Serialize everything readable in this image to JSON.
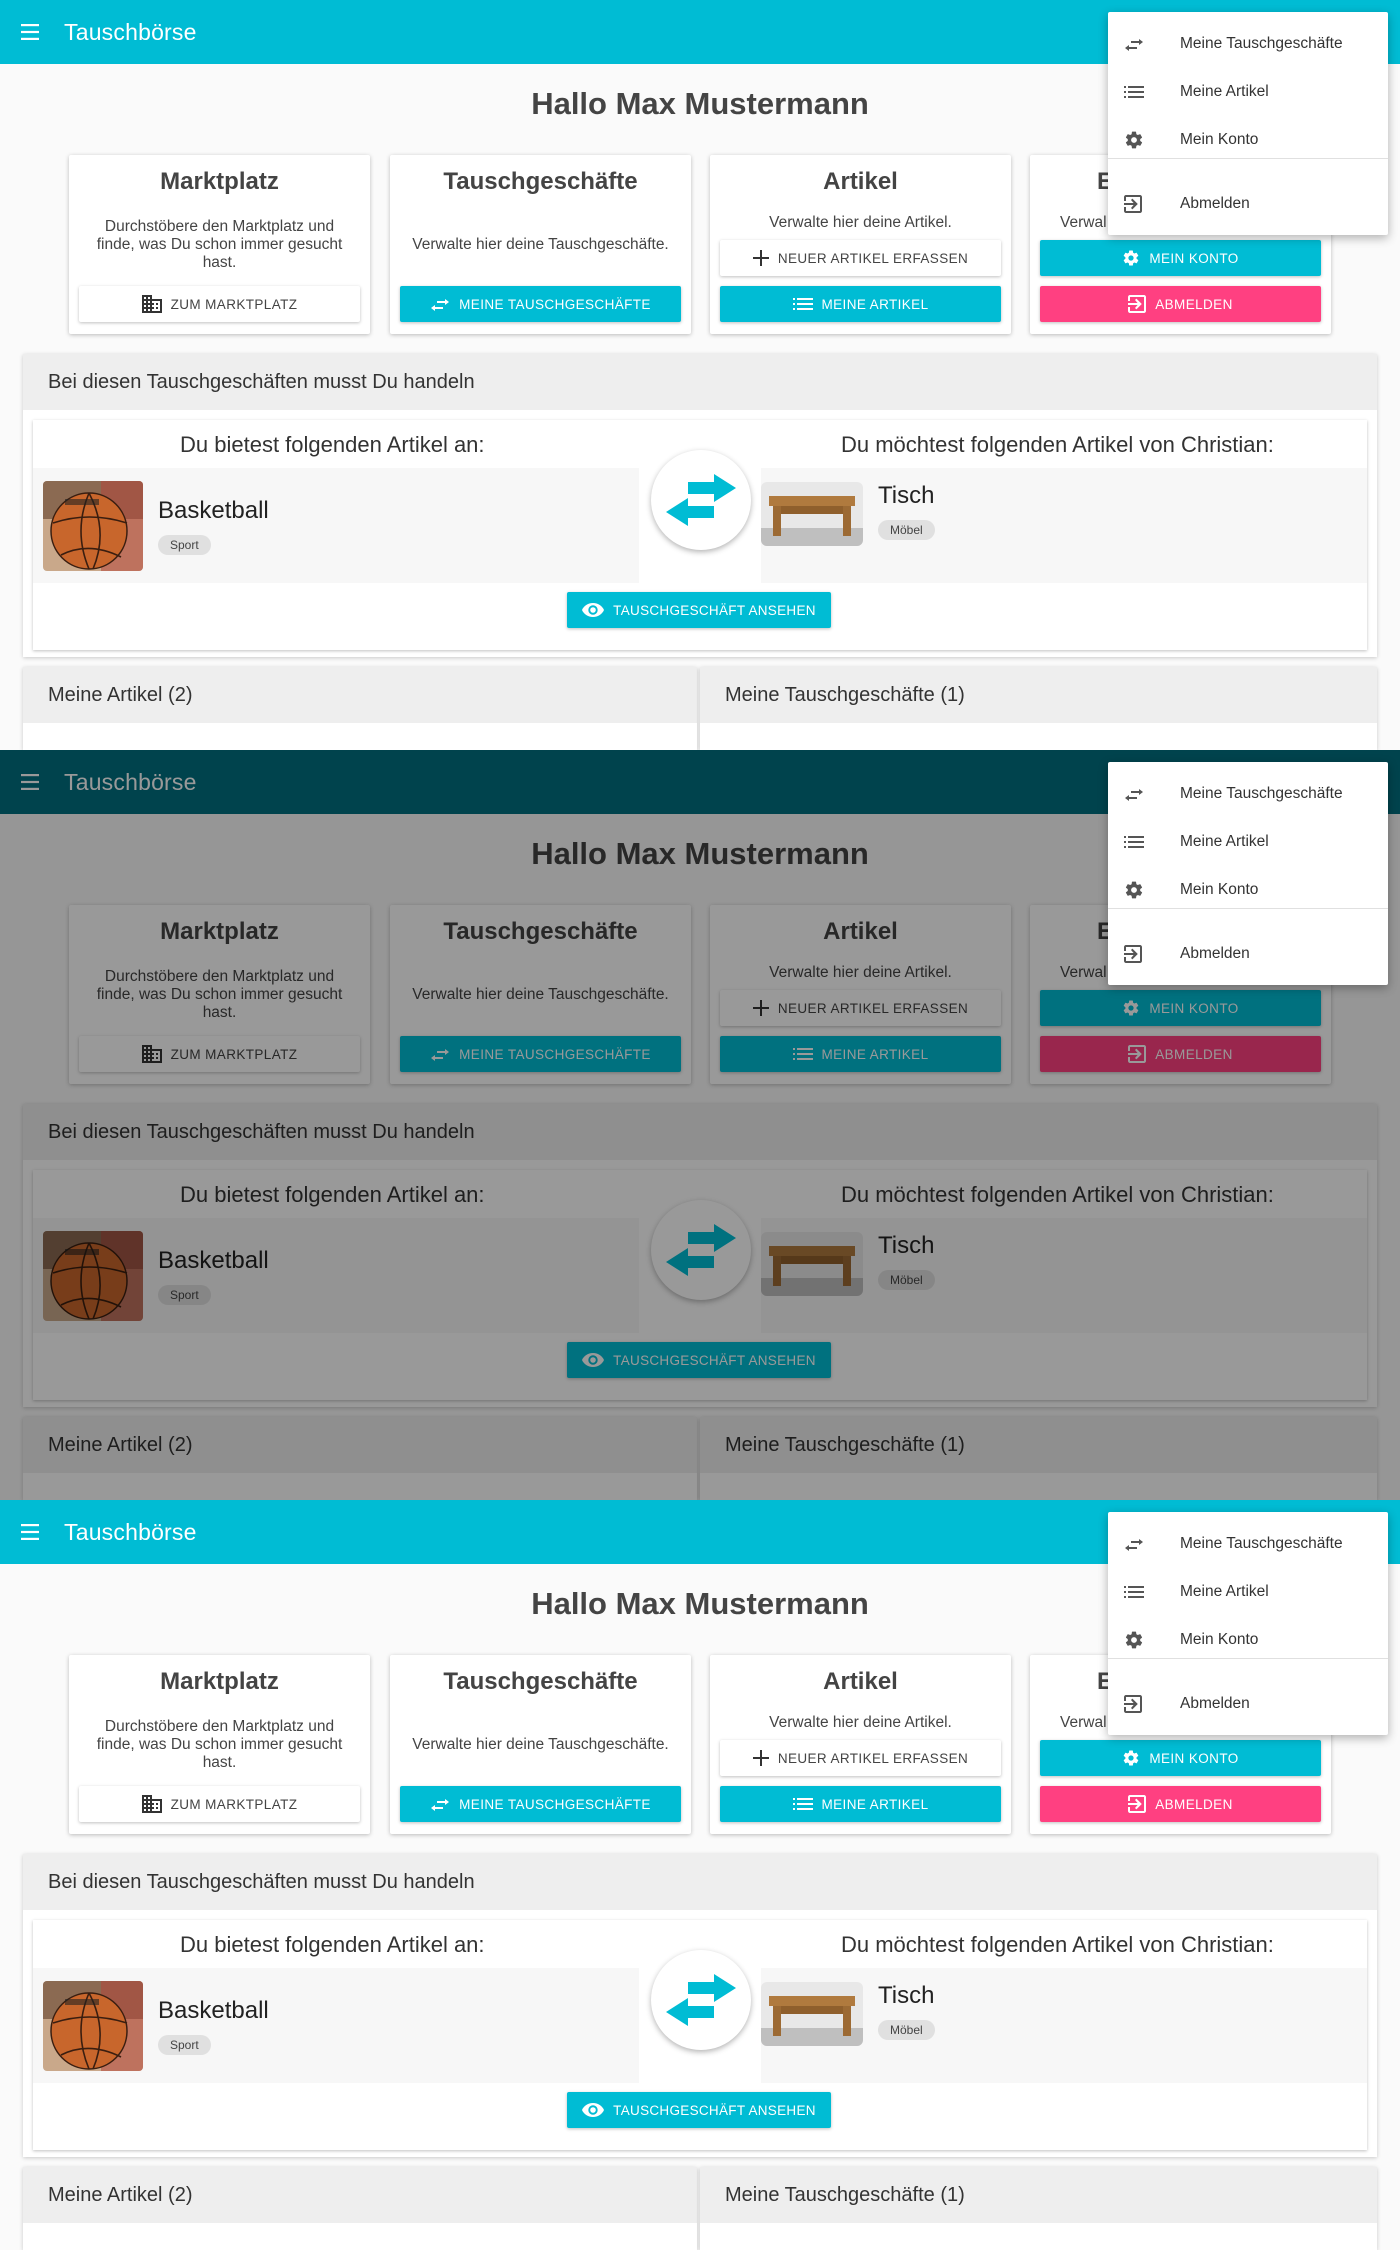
{
  "app": {
    "title": "Tauschbörse",
    "greeting": "Hallo Max Mustermann",
    "accent_color": "#00bcd4",
    "warn_color": "#ff4081"
  },
  "cards": [
    {
      "title": "Marktplatz",
      "description": "Durchstöbere den Marktplatz und finde, was Du schon immer gesucht hast.",
      "buttons": [
        "ZUM MARKTPLATZ"
      ]
    },
    {
      "title": "Tauschgeschäfte",
      "description": "Verwalte hier deine Tauschgeschäfte.",
      "buttons": [
        "MEINE TAUSCHGESCHÄFTE"
      ]
    },
    {
      "title": "Artikel",
      "description": "Verwalte hier deine Artikel.",
      "buttons": [
        "NEUER ARTIKEL ERFASSEN",
        "MEINE ARTIKEL"
      ]
    },
    {
      "title": "E",
      "description": "Verwal",
      "buttons": [
        "MEIN KONTO",
        "ABMELDEN"
      ]
    }
  ],
  "trade_panel": {
    "heading": "Bei diesen Tauschgeschäften musst Du handeln",
    "offer_title": "Du bietest folgenden Artikel an:",
    "want_title": "Du möchtest folgenden Artikel von Christian:",
    "offer_item": {
      "name": "Basketball",
      "category": "Sport",
      "icon": "basketball-image"
    },
    "want_item": {
      "name": "Tisch",
      "category": "Möbel",
      "icon": "table-image"
    },
    "view_button": "TAUSCHGESCHÄFT ANSEHEN"
  },
  "bottom_tabs": [
    "Meine Artikel (2)",
    "Meine Tauschgeschäfte (1)"
  ],
  "menu": {
    "items": [
      {
        "label": "Meine Tauschgeschäfte",
        "icon": "swap-icon"
      },
      {
        "label": "Meine Artikel",
        "icon": "list-icon"
      },
      {
        "label": "Mein Konto",
        "icon": "gear-icon"
      },
      {
        "label": "Abmelden",
        "icon": "logout-icon"
      }
    ]
  }
}
